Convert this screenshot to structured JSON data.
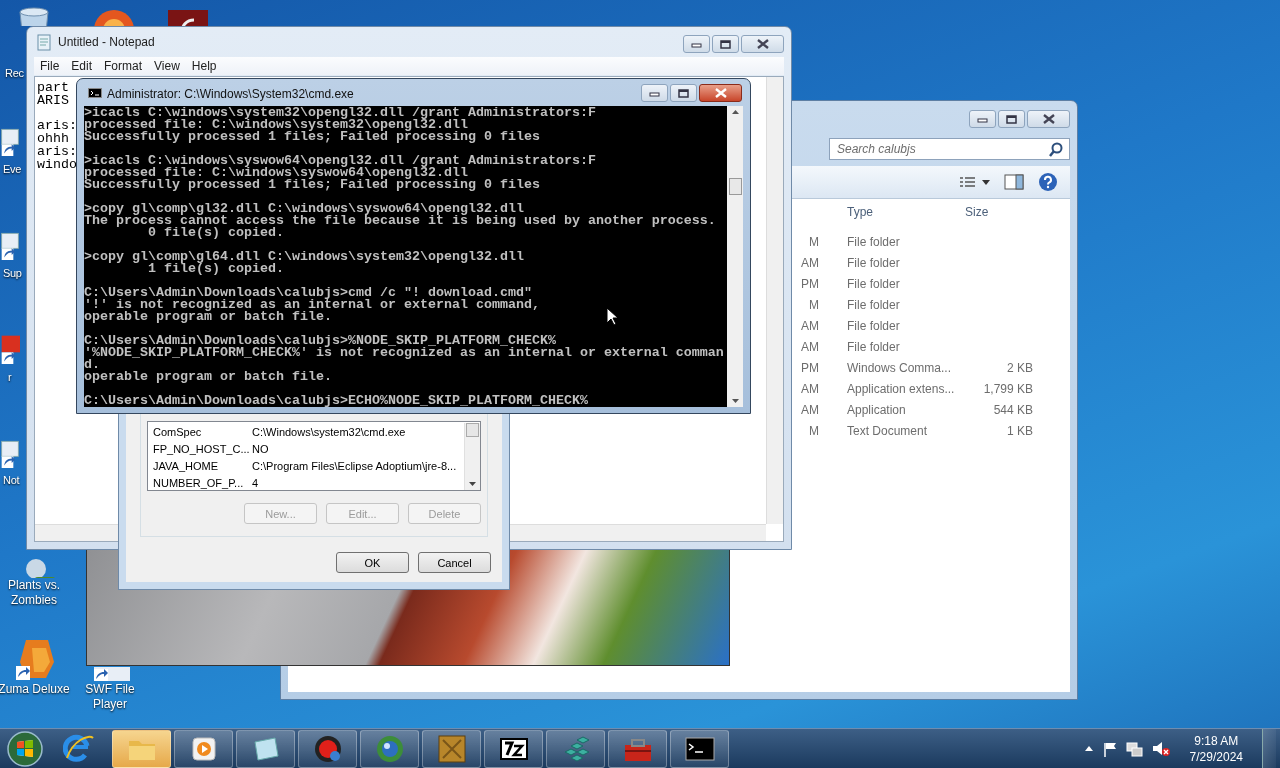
{
  "desktop_icons": [
    {
      "kind": "recycle-bin",
      "label": "Rec"
    },
    {
      "kind": "orange-app"
    },
    {
      "kind": "red-app"
    },
    {
      "kind": "shortcut",
      "label": "Eve"
    },
    {
      "kind": "shortcut",
      "label": "Sup"
    },
    {
      "kind": "red-shortcut",
      "label": "r"
    },
    {
      "kind": "shortcut",
      "label": "Not"
    },
    {
      "kind": "game",
      "label": "Plants vs. Zombies"
    },
    {
      "kind": "zuma",
      "label": "Zuma Deluxe"
    },
    {
      "kind": "swf",
      "label": "SWF File Player"
    }
  ],
  "explorer": {
    "search": {
      "placeholder": "Search calubjs"
    },
    "columns": [
      "Type",
      "Size"
    ],
    "rows": [
      {
        "modified": "M",
        "type": "File folder"
      },
      {
        "modified": "AM",
        "type": "File folder"
      },
      {
        "modified": "PM",
        "type": "File folder"
      },
      {
        "modified": "M",
        "type": "File folder"
      },
      {
        "modified": "AM",
        "type": "File folder"
      },
      {
        "modified": "AM",
        "type": "File folder"
      },
      {
        "modified": "PM",
        "type": "Windows Comma...",
        "size": "2 KB"
      },
      {
        "modified": "AM",
        "type": "Application extens...",
        "size": "1,799 KB"
      },
      {
        "modified": "AM",
        "type": "Application",
        "size": "544 KB"
      },
      {
        "modified": "M",
        "type": "Text Document",
        "size": "1 KB"
      }
    ]
  },
  "notepad": {
    "title": "Untitled - Notepad",
    "menu": [
      "File",
      "Edit",
      "Format",
      "View",
      "Help"
    ],
    "paragraphs": [
      [
        "part",
        "ARIS"
      ],
      [
        "aris:",
        "ohhh",
        "aris:",
        "windo"
      ]
    ]
  },
  "dialog": {
    "variables": [
      {
        "name": "ComSpec",
        "value": "C:\\Windows\\system32\\cmd.exe"
      },
      {
        "name": "FP_NO_HOST_C...",
        "value": "NO"
      },
      {
        "name": "JAVA_HOME",
        "value": "C:\\Program Files\\Eclipse Adoptium\\jre-8..."
      },
      {
        "name": "NUMBER_OF_P...",
        "value": "4"
      }
    ],
    "list_buttons": [
      {
        "label": "New...",
        "disabled": true
      },
      {
        "label": "Edit...",
        "disabled": true
      },
      {
        "label": "Delete",
        "disabled": true
      }
    ],
    "buttons": [
      {
        "label": "OK",
        "disabled": false
      },
      {
        "label": "Cancel",
        "disabled": false
      }
    ]
  },
  "cmd": {
    "title": "Administrator: C:\\Windows\\System32\\cmd.exe",
    "blocks": [
      [
        ">icacls C:\\windows\\system32\\opengl32.dll /grant Administrators:F",
        "processed file: C:\\windows\\system32\\opengl32.dll",
        "Successfully processed 1 files; Failed processing 0 files"
      ],
      [
        ">icacls C:\\windows\\syswow64\\opengl32.dll /grant Administrators:F",
        "processed file: C:\\windows\\syswow64\\opengl32.dll",
        "Successfully processed 1 files; Failed processing 0 files"
      ],
      [
        ">copy gl\\comp\\gl32.dll C:\\windows\\syswow64\\opengl32.dll",
        "The process cannot access the file because it is being used by another process.",
        "        0 file(s) copied."
      ],
      [
        ">copy gl\\comp\\gl64.dll C:\\windows\\system32\\opengl32.dll",
        "        1 file(s) copied."
      ],
      [
        "C:\\Users\\Admin\\Downloads\\calubjs>cmd /c \"! download.cmd\"",
        "'!' is not recognized as an internal or external command,",
        "operable program or batch file."
      ],
      [
        "C:\\Users\\Admin\\Downloads\\calubjs>%NODE_SKIP_PLATFORM_CHECK%",
        "'%NODE_SKIP_PLATFORM_CHECK%' is not recognized as an internal or external comman",
        "d.",
        "operable program or batch file."
      ],
      [
        "C:\\Users\\Admin\\Downloads\\calubjs>ECHO%NODE_SKIP_PLATFORM_CHECK%"
      ]
    ]
  },
  "taskbar": {
    "items": [
      {
        "kind": "browser"
      },
      {
        "kind": "folder"
      },
      {
        "kind": "media"
      },
      {
        "kind": "notepad"
      },
      {
        "kind": "red-disc"
      },
      {
        "kind": "globe"
      },
      {
        "kind": "dos"
      },
      {
        "kind": "archive"
      },
      {
        "kind": "cubes"
      },
      {
        "kind": "toolbox"
      },
      {
        "kind": "console"
      }
    ],
    "clock": {
      "time": "9:18 AM",
      "date": "7/29/2024"
    }
  }
}
